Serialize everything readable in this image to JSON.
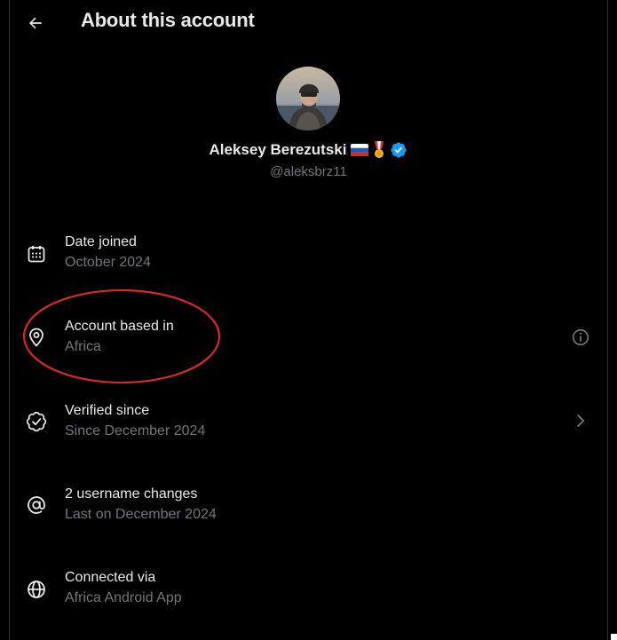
{
  "header": {
    "title": "About this account",
    "back_icon": "arrow-left-icon"
  },
  "profile": {
    "display_name": "Aleksey Berezutski",
    "name_emojis": [
      "russia-flag-icon",
      "medal-icon"
    ],
    "verified_badge": "verified-badge-icon",
    "handle": "@aleksbrz11"
  },
  "details": [
    {
      "icon": "calendar-icon",
      "label": "Date joined",
      "value": "October 2024"
    },
    {
      "icon": "location-pin-icon",
      "label": "Account based in",
      "value": "Africa",
      "trailing_icon": "info-icon"
    },
    {
      "icon": "verified-check-icon",
      "label": "Verified since",
      "value": "Since December 2024",
      "trailing_icon": "chevron-right-icon"
    },
    {
      "icon": "at-sign-icon",
      "label": "2 username changes",
      "value": "Last on December 2024"
    },
    {
      "icon": "globe-icon",
      "label": "Connected via",
      "value": "Africa Android App"
    }
  ],
  "colors": {
    "background": "#000000",
    "primary_text": "#e7e9ea",
    "secondary_text": "#71767b",
    "verified_blue": "#1d9bf0",
    "annotation_red": "#d42a2a"
  }
}
